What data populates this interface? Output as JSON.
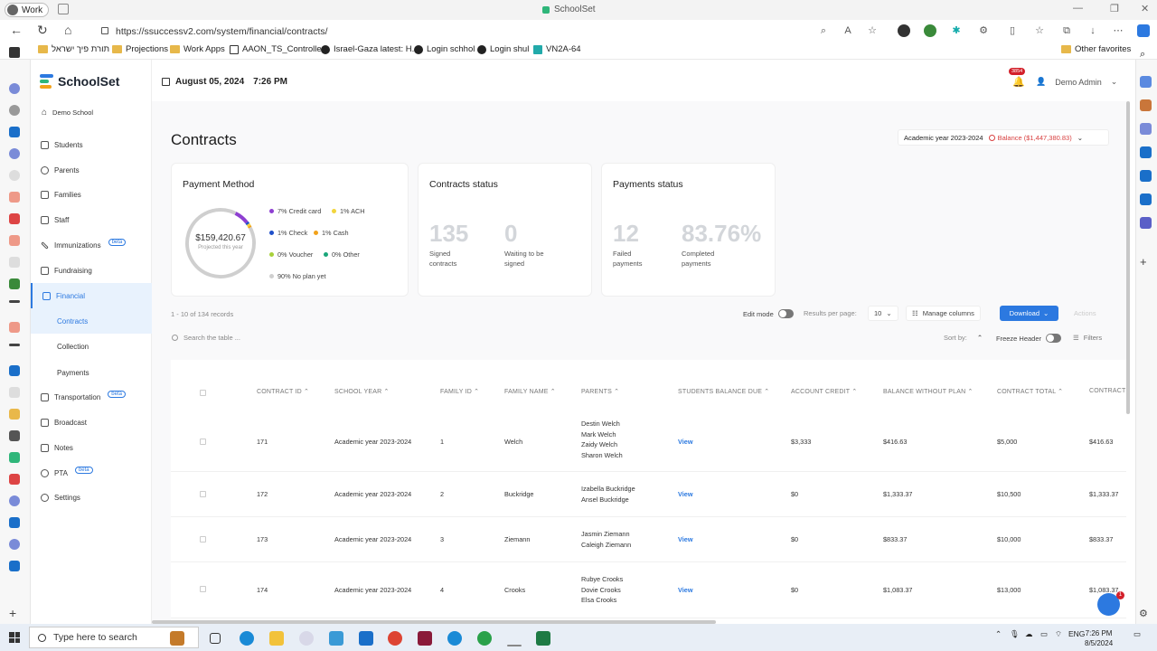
{
  "browser": {
    "profile": "Work",
    "window_title": "SchoolSet",
    "url": "https://ssuccessv2.com/system/financial/contracts/",
    "bookmarks": [
      "תורת פיך ישראל",
      "Projections",
      "Work Apps",
      "AAON_TS_Controlle...",
      "Israel-Gaza latest: H...",
      "Login schhol",
      "Login shul",
      "VN2A-64"
    ],
    "other_favorites": "Other favorites"
  },
  "app": {
    "brand": "SchoolSet",
    "school_name": "Demo School",
    "date": "August 05, 2024",
    "time": "7:26 PM",
    "notification_count": "3854",
    "user_name": "Demo Admin"
  },
  "sidebar": {
    "items": [
      {
        "label": "Students"
      },
      {
        "label": "Parents"
      },
      {
        "label": "Families"
      },
      {
        "label": "Staff"
      },
      {
        "label": "Immunizations",
        "badge": "beta"
      },
      {
        "label": "Fundraising"
      },
      {
        "label": "Financial"
      },
      {
        "label": "Transportation",
        "badge": "beta"
      },
      {
        "label": "Broadcast"
      },
      {
        "label": "Notes"
      },
      {
        "label": "PTA",
        "badge": "beta"
      },
      {
        "label": "Settings"
      }
    ],
    "financial_sub": [
      "Contracts",
      "Collection",
      "Payments"
    ]
  },
  "page": {
    "title": "Contracts",
    "year_select": "Academic year 2023-2024",
    "balance": "Balance ($1,447,380.83)"
  },
  "payment_method": {
    "title": "Payment Method",
    "total": "$159,420.67",
    "total_caption": "Projected this year",
    "legend": [
      {
        "label": "7% Credit card",
        "color": "#8e3fd1",
        "pct": 7
      },
      {
        "label": "1% ACH",
        "color": "#f2d53c",
        "pct": 1
      },
      {
        "label": "1% Check",
        "color": "#1f4fc9",
        "pct": 1
      },
      {
        "label": "1% Cash",
        "color": "#f2a21a",
        "pct": 1
      },
      {
        "label": "0% Voucher",
        "color": "#a8d13a",
        "pct": 0
      },
      {
        "label": "0% Other",
        "color": "#1aa67a",
        "pct": 0
      },
      {
        "label": "90% No plan yet",
        "color": "#cfcfcf",
        "pct": 90
      }
    ]
  },
  "contracts_status": {
    "title": "Contracts status",
    "signed_value": "135",
    "signed_label_1": "Signed",
    "signed_label_2": "contracts",
    "waiting_value": "0",
    "waiting_label_1": "Waiting to be",
    "waiting_label_2": "signed"
  },
  "payments_status": {
    "title": "Payments status",
    "failed_value": "12",
    "failed_label_1": "Failed",
    "failed_label_2": "payments",
    "completed_value": "83.76%",
    "completed_label_1": "Completed",
    "completed_label_2": "payments"
  },
  "toolbar": {
    "records": "1 - 10 of 134 records",
    "edit_mode": "Edit mode",
    "results_per_page": "Results per page:",
    "per_page_value": "10",
    "manage_columns": "Manage columns",
    "download": "Download",
    "actions": "Actions",
    "search_placeholder": "Search the table ...",
    "sort_by": "Sort by:",
    "freeze_header": "Freeze Header",
    "filters": "Filters"
  },
  "table": {
    "headers": [
      "CONTRACT ID",
      "SCHOOL YEAR",
      "FAMILY ID",
      "FAMILY NAME",
      "PARENTS",
      "STUDENTS BALANCE DUE",
      "ACCOUNT CREDIT",
      "BALANCE WITHOUT PLAN",
      "CONTRACT TOTAL",
      "CONTRACT"
    ],
    "rows": [
      {
        "contract_id": "171",
        "school_year": "Academic year 2023-2024",
        "family_id": "1",
        "family_name": "Welch",
        "parents": [
          "Destin Welch",
          "Mark Welch",
          "Zaidy Welch",
          "Sharon Welch"
        ],
        "balance_due": "View",
        "account_credit": "$3,333",
        "balance_without_plan": "$416.63",
        "contract_total": "$5,000",
        "contract": "$416.63"
      },
      {
        "contract_id": "172",
        "school_year": "Academic year 2023-2024",
        "family_id": "2",
        "family_name": "Buckridge",
        "parents": [
          "Izabella Buckridge",
          "Ansel Buckridge"
        ],
        "balance_due": "View",
        "account_credit": "$0",
        "balance_without_plan": "$1,333.37",
        "contract_total": "$10,500",
        "contract": "$1,333.37"
      },
      {
        "contract_id": "173",
        "school_year": "Academic year 2023-2024",
        "family_id": "3",
        "family_name": "Ziemann",
        "parents": [
          "Jasmin Ziemann",
          "Caleigh Ziemann"
        ],
        "balance_due": "View",
        "account_credit": "$0",
        "balance_without_plan": "$833.37",
        "contract_total": "$10,000",
        "contract": "$833.37"
      },
      {
        "contract_id": "174",
        "school_year": "Academic year 2023-2024",
        "family_id": "4",
        "family_name": "Crooks",
        "parents": [
          "Rubye Crooks",
          "Dovie Crooks",
          "Elsa Crooks"
        ],
        "balance_due": "View",
        "account_credit": "$0",
        "balance_without_plan": "$1,083.37",
        "contract_total": "$13,000",
        "contract": "$1,083.37"
      }
    ]
  },
  "chat_badge": "1",
  "taskbar": {
    "search_placeholder": "Type here to search",
    "language": "ENG",
    "time": "7:26 PM",
    "date": "8/5/2024"
  }
}
